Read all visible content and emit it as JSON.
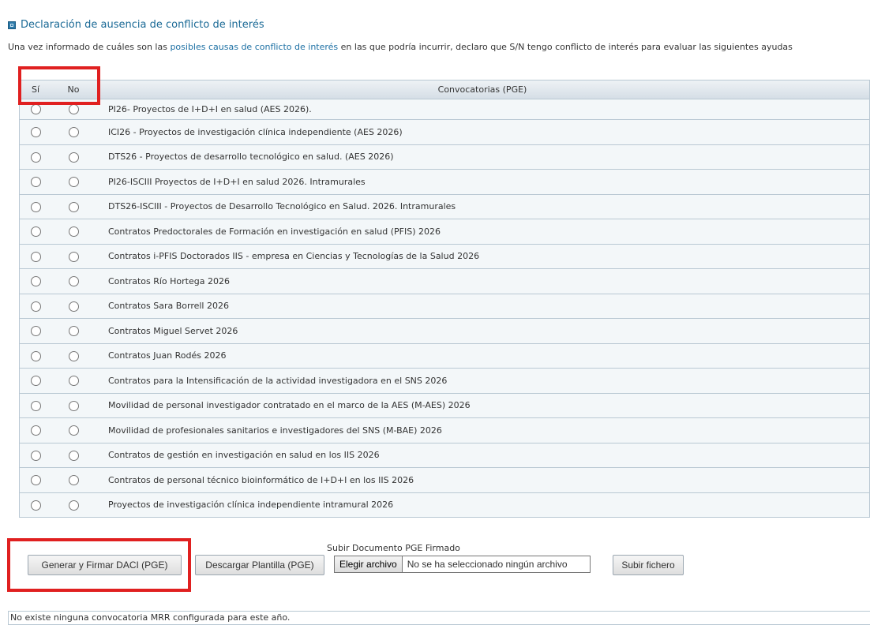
{
  "header": {
    "title": "Declaración de ausencia de conflicto de interés",
    "intro_before": "Una vez informado de cuáles son las ",
    "intro_link": "posibles causas de conflicto de interés",
    "intro_after": " en las que podría incurrir, declaro que S/N tengo conflicto de interés para evaluar las siguientes ayudas"
  },
  "table": {
    "col_si": "Sí",
    "col_no": "No",
    "col_convocatorias": "Convocatorias (PGE)",
    "rows": [
      "PI26- Proyectos de I+D+I en salud (AES 2026).",
      "ICI26 - Proyectos de investigación clínica independiente (AES 2026)",
      "DTS26 - Proyectos de desarrollo tecnológico en salud. (AES 2026)",
      "PI26-ISCIII Proyectos de I+D+I en salud 2026. Intramurales",
      "DTS26-ISCIII - Proyectos de Desarrollo Tecnológico en Salud. 2026. Intramurales",
      "Contratos Predoctorales de Formación en investigación en salud (PFIS) 2026",
      "Contratos i-PFIS Doctorados IIS - empresa en Ciencias y Tecnologías de la Salud 2026",
      "Contratos Río Hortega 2026",
      "Contratos Sara Borrell 2026",
      "Contratos Miguel Servet 2026",
      "Contratos Juan Rodés 2026",
      "Contratos para la Intensificación de la actividad investigadora en el SNS 2026",
      "Movilidad de personal investigador contratado en el marco de la AES (M-AES) 2026",
      "Movilidad de profesionales sanitarios e investigadores del SNS (M-BAE) 2026",
      "Contratos de gestión en investigación en salud en los IIS 2026",
      "Contratos de personal técnico bioinformático de I+D+I en los IIS 2026",
      "Proyectos de investigación clínica independiente intramural 2026"
    ]
  },
  "actions": {
    "generate_label": "Generar y Firmar DACI (PGE)",
    "download_label": "Descargar Plantilla (PGE)",
    "upload_title": "Subir Documento PGE Firmado",
    "choose_file_label": "Elegir archivo",
    "no_file_label": "No se ha seleccionado ningún archivo",
    "upload_button_label": "Subir fichero"
  },
  "footer": {
    "message": "No existe ninguna convocatoria MRR configurada para este año."
  },
  "colors": {
    "accent": "#1b6a96",
    "highlight": "#e02020",
    "row_bg": "#f3f7f9"
  }
}
